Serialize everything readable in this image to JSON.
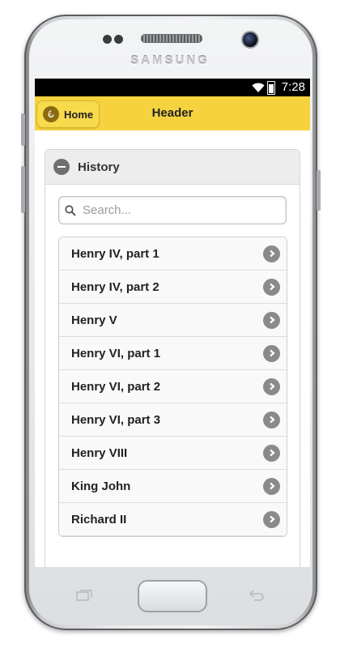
{
  "device": {
    "brand": "SAMSUNG"
  },
  "statusbar": {
    "time": "7:28"
  },
  "appbar": {
    "home_label": "Home",
    "title": "Header"
  },
  "collapsible": {
    "title": "History"
  },
  "search": {
    "placeholder": "Search..."
  },
  "list": [
    {
      "label": "Henry IV, part 1"
    },
    {
      "label": "Henry IV, part 2"
    },
    {
      "label": "Henry V"
    },
    {
      "label": "Henry VI, part 1"
    },
    {
      "label": "Henry VI, part 2"
    },
    {
      "label": "Henry VI, part 3"
    },
    {
      "label": "Henry VIII"
    },
    {
      "label": "King John"
    },
    {
      "label": "Richard II"
    }
  ],
  "colors": {
    "appbar": "#f6d33e",
    "chevron": "#8a8a8a"
  },
  "icons": [
    "home-back-icon",
    "minus-icon",
    "search-icon",
    "chevron-right-icon",
    "wifi-icon",
    "battery-icon"
  ]
}
